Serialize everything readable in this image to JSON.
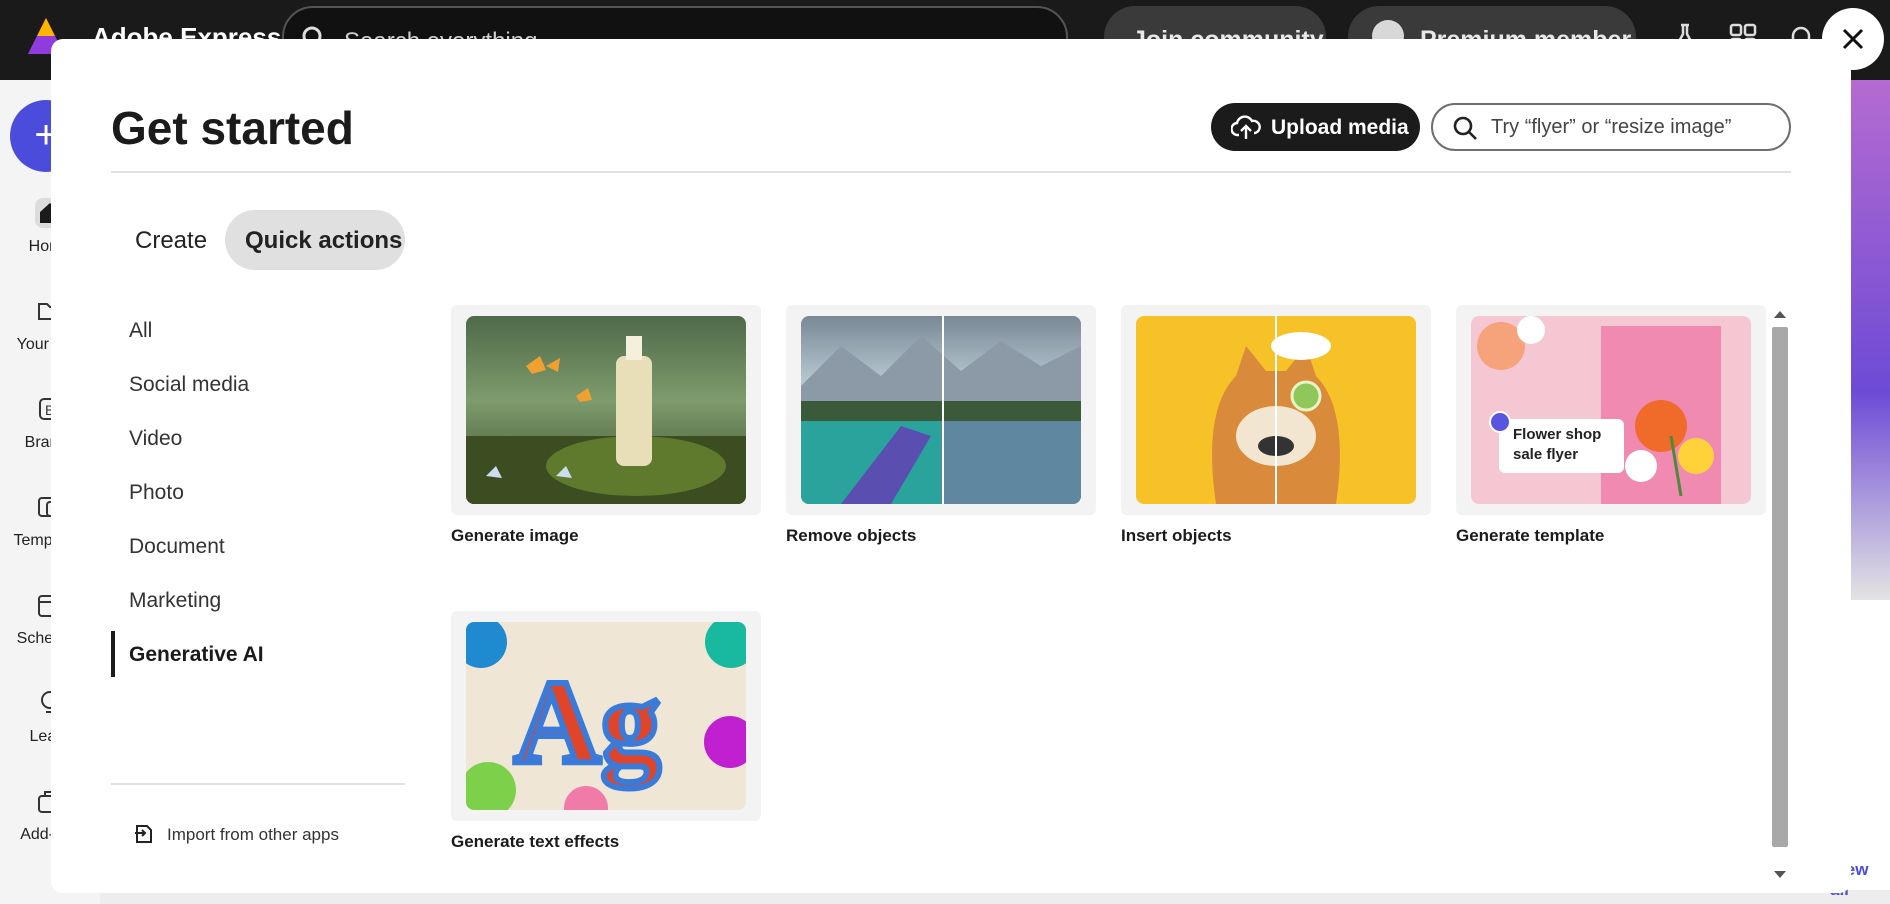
{
  "app": {
    "name": "Adobe Express",
    "search_placeholder": "Search everything",
    "join_label": "Join community",
    "premium_label": "Premium member"
  },
  "sidebar": {
    "create_symbol": "+",
    "items": [
      {
        "label": "Home",
        "icon": "home-icon"
      },
      {
        "label": "Your stuff",
        "icon": "folder-icon"
      },
      {
        "label": "Brands",
        "icon": "brand-icon"
      },
      {
        "label": "Templates",
        "icon": "templates-icon"
      },
      {
        "label": "Schedule",
        "icon": "calendar-icon"
      },
      {
        "label": "Learn",
        "icon": "bulb-icon"
      },
      {
        "label": "Add-ons",
        "icon": "addons-icon"
      }
    ]
  },
  "background": {
    "view_all_label": "View all"
  },
  "modal": {
    "title": "Get started",
    "upload_label": "Upload media",
    "search_placeholder": "Try “flyer” or “resize image”",
    "tabs": [
      {
        "label": "Create",
        "active": false
      },
      {
        "label": "Quick actions",
        "active": true
      }
    ],
    "categories": [
      {
        "label": "All",
        "active": false
      },
      {
        "label": "Social media",
        "active": false
      },
      {
        "label": "Video",
        "active": false
      },
      {
        "label": "Photo",
        "active": false
      },
      {
        "label": "Document",
        "active": false
      },
      {
        "label": "Marketing",
        "active": false
      },
      {
        "label": "Generative AI",
        "active": true
      }
    ],
    "import_label": "Import from other apps",
    "cards": [
      {
        "label": "Generate image"
      },
      {
        "label": "Remove objects"
      },
      {
        "label": "Insert objects"
      },
      {
        "label": "Generate template",
        "badge_line1": "Flower shop",
        "badge_line2": "sale flyer"
      },
      {
        "label": "Generate text effects",
        "art_text": "Ag"
      }
    ]
  },
  "colors": {
    "accent": "#4b4cdc",
    "dark": "#1b1b1b",
    "active_tab_bg": "#e0e0e0"
  }
}
